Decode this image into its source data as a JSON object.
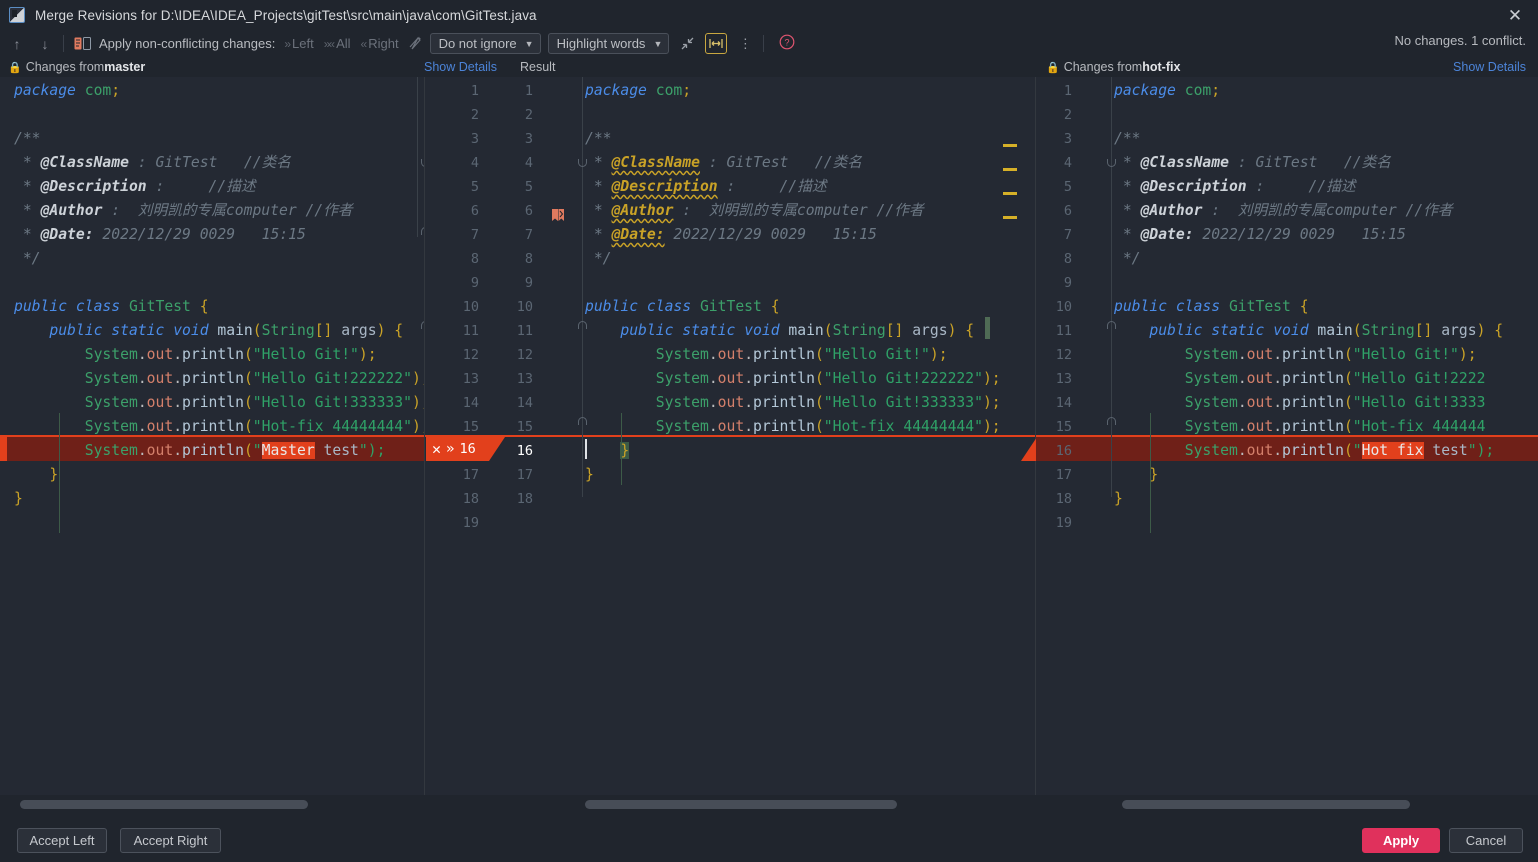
{
  "window": {
    "title": "Merge Revisions for D:\\IDEA\\IDEA_Projects\\gitTest\\src\\main\\java\\com\\GitTest.java",
    "close_label": "✕",
    "app_icon": "idea-icon"
  },
  "toolbar": {
    "prev_label": "↑",
    "next_label": "↓",
    "apply_label": "Apply non-conflicting changes:",
    "left_label": "Left",
    "all_label": "All",
    "right_label": "Right",
    "ignore_select": "Do not ignore",
    "highlight_select": "Highlight words",
    "collapse_label": "collapse-unchanged-icon",
    "whitespace_label": "show-whitespace-icon",
    "more_label": "⋮",
    "help_label": "?",
    "status": "No changes. 1 conflict."
  },
  "headers": {
    "left_prefix": "Changes from ",
    "left_branch": "master",
    "left_show_details": "Show Details",
    "result_label": "Result",
    "center_show_details": "Show Details",
    "right_prefix": "Changes from ",
    "right_branch": "hot-fix",
    "right_show_details": "Show Details"
  },
  "conflict": {
    "left_line": "16",
    "right_line": "16",
    "center_line": "16",
    "accept_left_icon": "✕",
    "apply_left_icon": "»",
    "apply_right_icon": "«",
    "reject_right_icon": "✕"
  },
  "colors": {
    "accent": "#e0315c",
    "conflict": "#e2401c",
    "conflict_bg": "#6f2018",
    "link": "#4c84d8",
    "warning": "#d6b028",
    "editor_bg": "#242933",
    "chrome_bg": "#20252d"
  },
  "buttons": {
    "accept_left": "Accept Left",
    "accept_right": "Accept Right",
    "apply": "Apply",
    "cancel": "Cancel"
  },
  "left_pane": {
    "lines": [
      "package com;",
      "",
      "/**",
      " * @ClassName : GitTest   //类名",
      " * @Description :     //描述",
      " * @Author :  刘明凯的专属computer //作者",
      " * @Date: 2022/12/29 0029   15:15",
      " */",
      "",
      "public class GitTest {",
      "    public static void main(String[] args) {",
      "        System.out.println(\"Hello Git!\");",
      "        System.out.println(\"Hello Git!222222\");",
      "        System.out.println(\"Hello Git!333333\");",
      "        System.out.println(\"Hot-fix 44444444\");",
      "        System.out.println(\"Master test\");",
      "    }",
      "}"
    ],
    "conflict_word": "Master"
  },
  "center_pane": {
    "line_numbers_left": [
      "1",
      "2",
      "3",
      "4",
      "5",
      "6",
      "7",
      "8",
      "9",
      "10",
      "11",
      "12",
      "13",
      "14",
      "15",
      "16",
      "17",
      "18",
      "19"
    ],
    "line_numbers_right": [
      "1",
      "2",
      "3",
      "4",
      "5",
      "6",
      "7",
      "8",
      "9",
      "10",
      "11",
      "12",
      "13",
      "14",
      "15",
      "16",
      "17",
      "18",
      ""
    ],
    "lines": [
      "package com;",
      "",
      "/**",
      " * @ClassName : GitTest   //类名",
      " * @Description :     //描述",
      " * @Author :  刘明凯的专属computer //作者",
      " * @Date: 2022/12/29 0029   15:15",
      " */",
      "",
      "public class GitTest {",
      "    public static void main(String[] args) {",
      "        System.out.println(\"Hello Git!\");",
      "        System.out.println(\"Hello Git!222222\");",
      "        System.out.println(\"Hello Git!333333\");",
      "        System.out.println(\"Hot-fix 44444444\");",
      "    }",
      "}",
      "",
      ""
    ]
  },
  "right_pane": {
    "lines": [
      "package com;",
      "",
      "/**",
      " * @ClassName : GitTest   //类名",
      " * @Description :     //描述",
      " * @Author :  刘明凯的专属computer //作者",
      " * @Date: 2022/12/29 0029   15:15",
      " */",
      "",
      "public class GitTest {",
      "    public static void main(String[] args) {",
      "        System.out.println(\"Hello Git!\");",
      "        System.out.println(\"Hello Git!2222",
      "        System.out.println(\"Hello Git!3333",
      "        System.out.println(\"Hot-fix 444444",
      "        System.out.println(\"Hot fix test\");",
      "    }",
      "}"
    ],
    "line_numbers": [
      "1",
      "2",
      "3",
      "4",
      "5",
      "6",
      "7",
      "8",
      "9",
      "10",
      "11",
      "12",
      "13",
      "14",
      "15",
      "16",
      "17",
      "18",
      "19"
    ],
    "conflict_word": "Hot fix"
  }
}
